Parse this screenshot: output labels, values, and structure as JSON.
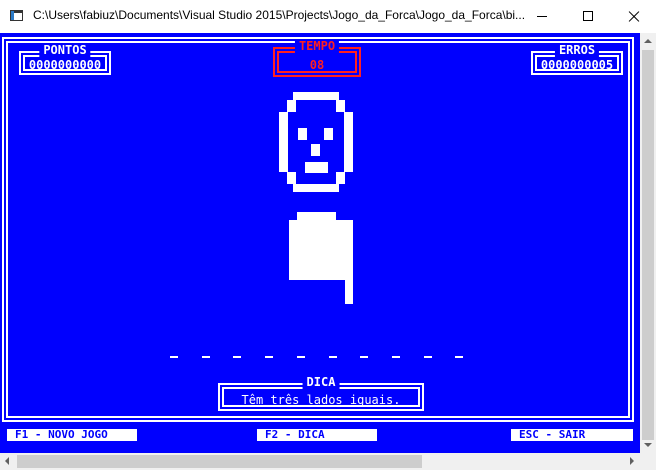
{
  "window": {
    "title": "C:\\Users\\fabiuz\\Documents\\Visual Studio 2015\\Projects\\Jogo_da_Forca\\Jogo_da_Forca\\bi...",
    "controls": [
      "minimize",
      "maximize",
      "close"
    ]
  },
  "game": {
    "score_label": "PONTOS",
    "score_value": "0000000000",
    "time_label": "TEMPO",
    "time_value": "08",
    "errors_label": "ERROS",
    "errors_value": "0000000005",
    "word_length": 10,
    "hint_label": "DICA",
    "hint_text": "Têm três lados iguais."
  },
  "footer": {
    "f1": "F1 - NOVO JOGO",
    "f2": "F2 - DICA",
    "esc": "ESC - SAIR"
  },
  "colors": {
    "console_background": "#0000fe",
    "foreground": "#ffffff",
    "timer": "#ff2020"
  },
  "icons": {
    "app": "console-app-icon",
    "hangman": "hangman-figure"
  }
}
